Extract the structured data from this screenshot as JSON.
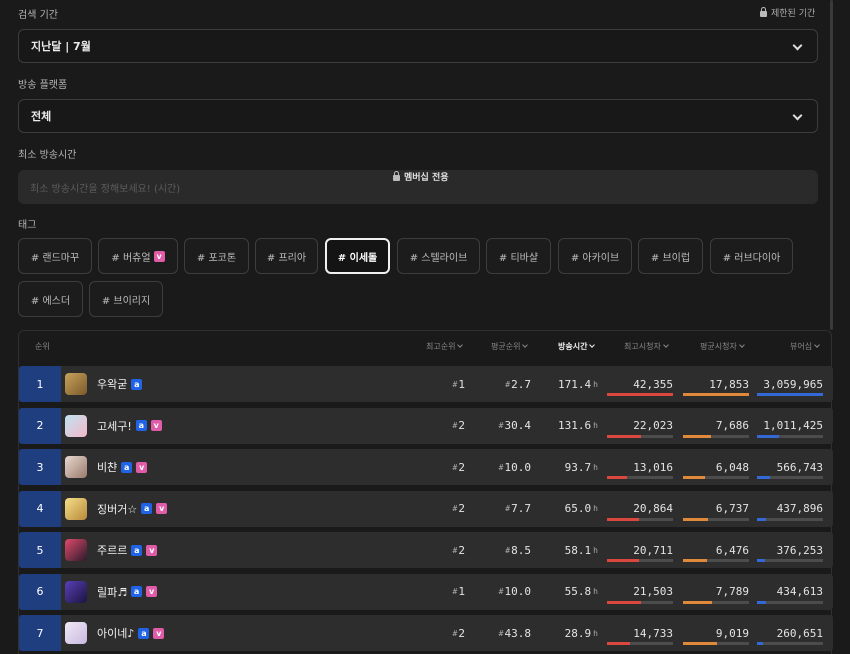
{
  "period": {
    "label": "검색 기간",
    "restricted_label": "제한된 기간",
    "value": "지난달 | 7월"
  },
  "platform": {
    "label": "방송 플랫폼",
    "value": "전체"
  },
  "min_time": {
    "label": "최소 방송시간",
    "placeholder": "최소 방송시간을 정해보세요! (시간)",
    "member_label": "멤버십 전용"
  },
  "tags": {
    "label": "태그",
    "items": [
      {
        "label": "# 랜드마꾸",
        "badge": ""
      },
      {
        "label": "# 버츄얼",
        "badge": "v"
      },
      {
        "label": "# 포코톤",
        "badge": ""
      },
      {
        "label": "# 프리아",
        "badge": ""
      },
      {
        "label": "# 이세돌",
        "badge": "",
        "active": true
      },
      {
        "label": "# 스텔라이브",
        "badge": ""
      },
      {
        "label": "# 티바샬",
        "badge": ""
      },
      {
        "label": "# 아카이브",
        "badge": ""
      },
      {
        "label": "# 브이럽",
        "badge": ""
      },
      {
        "label": "# 러브다이아",
        "badge": ""
      },
      {
        "label": "# 에스더",
        "badge": ""
      },
      {
        "label": "# 브이리지",
        "badge": ""
      }
    ]
  },
  "table": {
    "headers": {
      "rank": "순위",
      "best_rank": "최고순위",
      "avg_rank": "평균순위",
      "broadcast_time": "방송시간",
      "peak_viewers": "최고시청자",
      "avg_viewers": "평균시청자",
      "total_viewers": "뷰어십"
    },
    "rank_prefix": "#",
    "hour_suffix": "h",
    "accent_colors": {
      "rank_bg": "#1f3e80",
      "peak": "#d9473f",
      "avg": "#e0893a",
      "total": "#3468d6"
    },
    "rows": [
      {
        "rank": "1",
        "name": "우왁굳",
        "badges": [
          "a"
        ],
        "best_rank": "1",
        "avg_rank": "2.7",
        "time": "171.4",
        "peak": "42,355",
        "avg": "17,853",
        "total": "3,059,965",
        "peak_ratio": 1.0,
        "avg_ratio": 1.0,
        "total_ratio": 1.0
      },
      {
        "rank": "2",
        "name": "고세구!",
        "badges": [
          "a",
          "v"
        ],
        "best_rank": "2",
        "avg_rank": "30.4",
        "time": "131.6",
        "peak": "22,023",
        "avg": "7,686",
        "total": "1,011,425",
        "peak_ratio": 0.52,
        "avg_ratio": 0.43,
        "total_ratio": 0.33
      },
      {
        "rank": "3",
        "name": "비챤",
        "badges": [
          "a",
          "v"
        ],
        "best_rank": "2",
        "avg_rank": "10.0",
        "time": "93.7",
        "peak": "13,016",
        "avg": "6,048",
        "total": "566,743",
        "peak_ratio": 0.31,
        "avg_ratio": 0.34,
        "total_ratio": 0.19
      },
      {
        "rank": "4",
        "name": "징버거☆",
        "badges": [
          "a",
          "v"
        ],
        "best_rank": "2",
        "avg_rank": "7.7",
        "time": "65.0",
        "peak": "20,864",
        "avg": "6,737",
        "total": "437,896",
        "peak_ratio": 0.49,
        "avg_ratio": 0.38,
        "total_ratio": 0.14
      },
      {
        "rank": "5",
        "name": "주르르",
        "badges": [
          "a",
          "v"
        ],
        "best_rank": "2",
        "avg_rank": "8.5",
        "time": "58.1",
        "peak": "20,711",
        "avg": "6,476",
        "total": "376,253",
        "peak_ratio": 0.49,
        "avg_ratio": 0.36,
        "total_ratio": 0.12
      },
      {
        "rank": "6",
        "name": "릴파♬",
        "badges": [
          "a",
          "v"
        ],
        "best_rank": "1",
        "avg_rank": "10.0",
        "time": "55.8",
        "peak": "21,503",
        "avg": "7,789",
        "total": "434,613",
        "peak_ratio": 0.51,
        "avg_ratio": 0.44,
        "total_ratio": 0.14
      },
      {
        "rank": "7",
        "name": "아이네♪",
        "badges": [
          "a",
          "v"
        ],
        "best_rank": "2",
        "avg_rank": "43.8",
        "time": "28.9",
        "peak": "14,733",
        "avg": "9,019",
        "total": "260,651",
        "peak_ratio": 0.35,
        "avg_ratio": 0.51,
        "total_ratio": 0.09
      }
    ]
  }
}
